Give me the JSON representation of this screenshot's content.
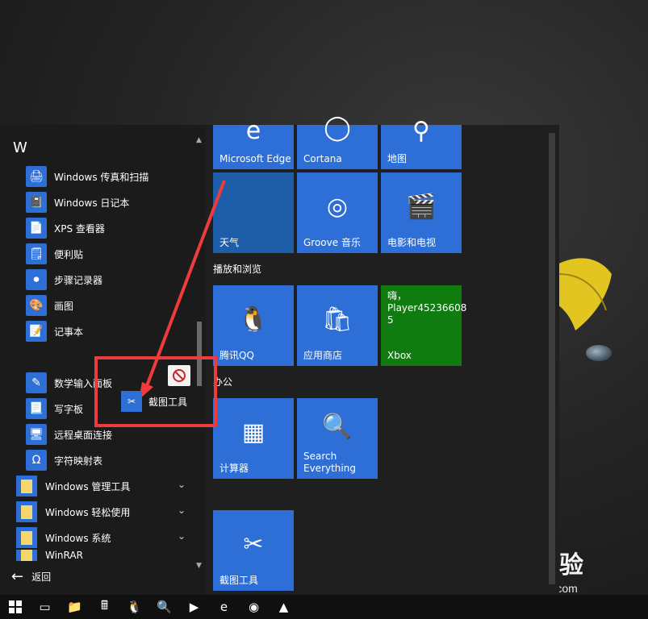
{
  "start_menu": {
    "section_letter": "W",
    "apps": [
      {
        "label": "Windows 传真和扫描",
        "icon": "fax-scan-icon",
        "glyph": "🖨"
      },
      {
        "label": "Windows 日记本",
        "icon": "journal-icon",
        "glyph": "📓"
      },
      {
        "label": "XPS 查看器",
        "icon": "xps-viewer-icon",
        "glyph": "📄"
      },
      {
        "label": "便利贴",
        "icon": "sticky-notes-icon",
        "glyph": "🗒"
      },
      {
        "label": "步骤记录器",
        "icon": "steps-recorder-icon",
        "glyph": "⏺"
      },
      {
        "label": "画图",
        "icon": "paint-icon",
        "glyph": "🎨"
      },
      {
        "label": "记事本",
        "icon": "notepad-icon",
        "glyph": "📝"
      },
      {
        "label": "数学输入面板",
        "icon": "math-input-icon",
        "glyph": "✎"
      },
      {
        "label": "写字板",
        "icon": "wordpad-icon",
        "glyph": "📃"
      },
      {
        "label": "远程桌面连接",
        "icon": "remote-desktop-icon",
        "glyph": "🖥"
      },
      {
        "label": "字符映射表",
        "icon": "character-map-icon",
        "glyph": "Ω"
      }
    ],
    "folders": [
      {
        "label": "Windows 管理工具"
      },
      {
        "label": "Windows 轻松使用"
      },
      {
        "label": "Windows 系统"
      },
      {
        "label": "WinRAR"
      }
    ],
    "back_label": "返回"
  },
  "tiles": {
    "top_row": [
      {
        "label": "Microsoft Edge",
        "icon": "edge-icon",
        "glyph": "e"
      },
      {
        "label": "Cortana",
        "icon": "cortana-icon",
        "glyph": "◯"
      },
      {
        "label": "地图",
        "icon": "maps-icon",
        "glyph": "⚲"
      }
    ],
    "row2": [
      {
        "label": "天气",
        "icon": "weather-icon",
        "glyph": ""
      },
      {
        "label": "Groove 音乐",
        "icon": "groove-music-icon",
        "glyph": "◎"
      },
      {
        "label": "电影和电视",
        "icon": "movies-tv-icon",
        "glyph": "🎬"
      }
    ],
    "group_play": "播放和浏览",
    "row3": [
      {
        "label": "腾讯QQ",
        "icon": "qq-icon",
        "glyph": "🐧"
      },
      {
        "label": "应用商店",
        "icon": "store-icon",
        "glyph": "🛍"
      },
      {
        "label": "嗨，\nPlayer45236608\n5",
        "sub": "Xbox",
        "icon": "xbox-icon"
      }
    ],
    "group_office": "办公",
    "row4": [
      {
        "label": "计算器",
        "icon": "calculator-icon",
        "glyph": "▦"
      },
      {
        "label": "Search\nEverything",
        "icon": "search-everything-icon",
        "glyph": "🔍"
      }
    ],
    "pinned": {
      "label": "截图工具",
      "icon": "snipping-tool-icon",
      "glyph": "✂"
    }
  },
  "drag_ghost": {
    "label": "截图工具"
  },
  "watermark": {
    "logo": "Bai 经验",
    "url": "jingyan.baidu.com"
  },
  "colors": {
    "tile_blue": "#2d6fd6",
    "xbox_green": "#107c10",
    "annotation_red": "#ef3b3b"
  }
}
